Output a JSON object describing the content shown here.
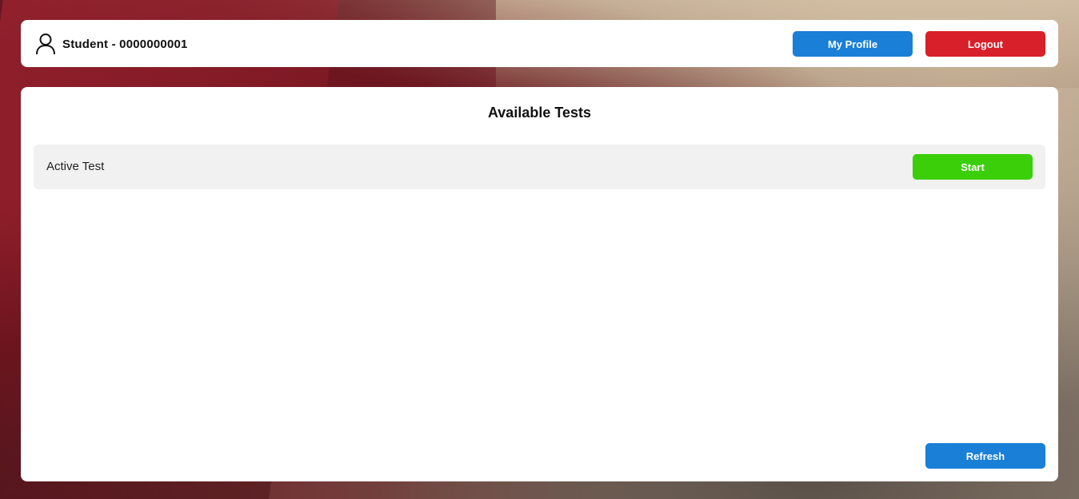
{
  "header": {
    "user_label": "Student - 0000000001",
    "user_icon": "user-outline-icon",
    "profile_button": "My Profile",
    "logout_button": "Logout"
  },
  "main": {
    "title": "Available Tests",
    "tests": [
      {
        "name": "Active Test",
        "action": "Start"
      }
    ],
    "refresh_button": "Refresh"
  },
  "colors": {
    "primary_blue": "#1a7fd6",
    "logout_red": "#d8202a",
    "start_green": "#3bcf0a",
    "row_bg": "#f1f1f1"
  }
}
